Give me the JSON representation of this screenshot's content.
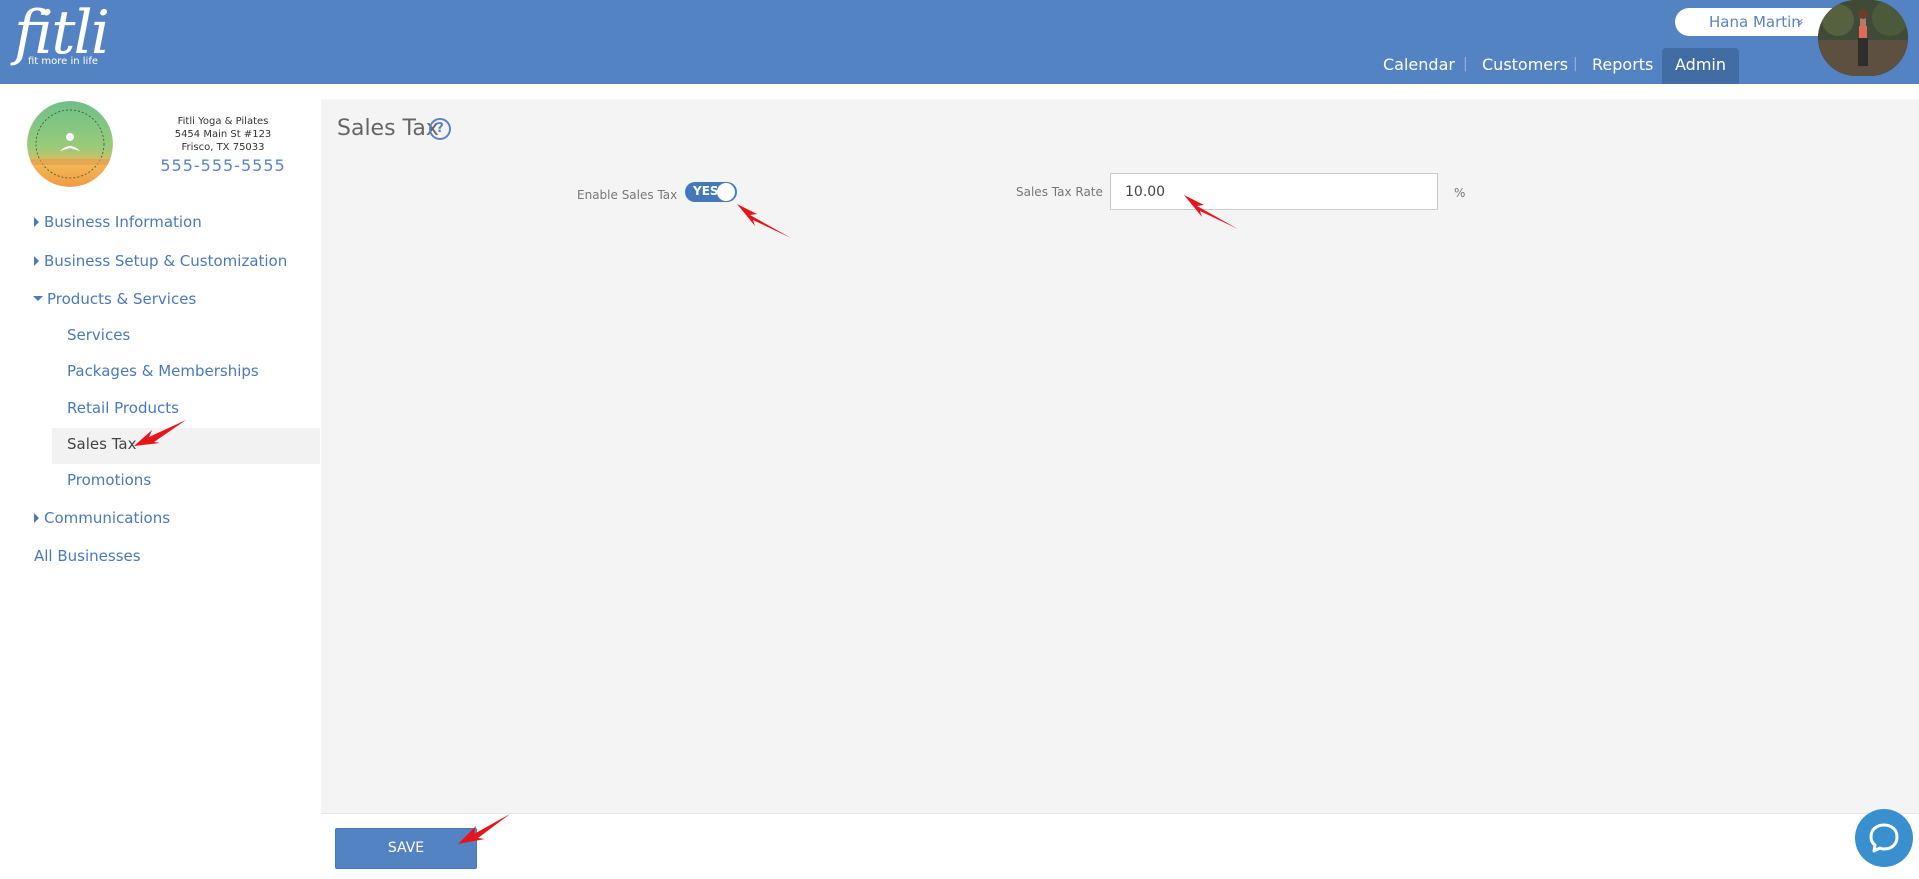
{
  "header": {
    "logo_text": "fitli",
    "logo_tagline": "fit more in life",
    "user_name": "Hana Martin",
    "user_chevron": "»",
    "nav": [
      {
        "label": "Calendar"
      },
      {
        "label": "Customers"
      },
      {
        "label": "Reports"
      },
      {
        "label": "Admin",
        "active": true
      }
    ],
    "separator": "|"
  },
  "business": {
    "name": "Fitli Yoga & Pilates",
    "address_line1": "5454 Main St #123",
    "address_line2": "Frisco, TX 75033",
    "phone": "555-555-5555",
    "logo_text": "FITLI YOGA & PILATES"
  },
  "sidebar": {
    "business_information": "Business Information",
    "business_setup": "Business Setup & Customization",
    "products_services": "Products & Services",
    "sub_items": [
      {
        "label": "Services"
      },
      {
        "label": "Packages & Memberships"
      },
      {
        "label": "Retail Products"
      },
      {
        "label": "Sales Tax",
        "active": true
      },
      {
        "label": "Promotions"
      }
    ],
    "communications": "Communications",
    "all_businesses": "All Businesses"
  },
  "main": {
    "title": "Sales Tax",
    "help_symbol": "?",
    "enable_label": "Enable Sales Tax",
    "toggle_text": "YES",
    "toggle_on": true,
    "rate_label": "Sales Tax Rate",
    "rate_value": "10.00",
    "rate_unit": "%",
    "save_label": "SAVE"
  },
  "colors": {
    "brand_blue": "#5483c4",
    "nav_active": "#416ca4",
    "link_blue": "#4a79bd",
    "annotation_red": "#e8141b"
  }
}
